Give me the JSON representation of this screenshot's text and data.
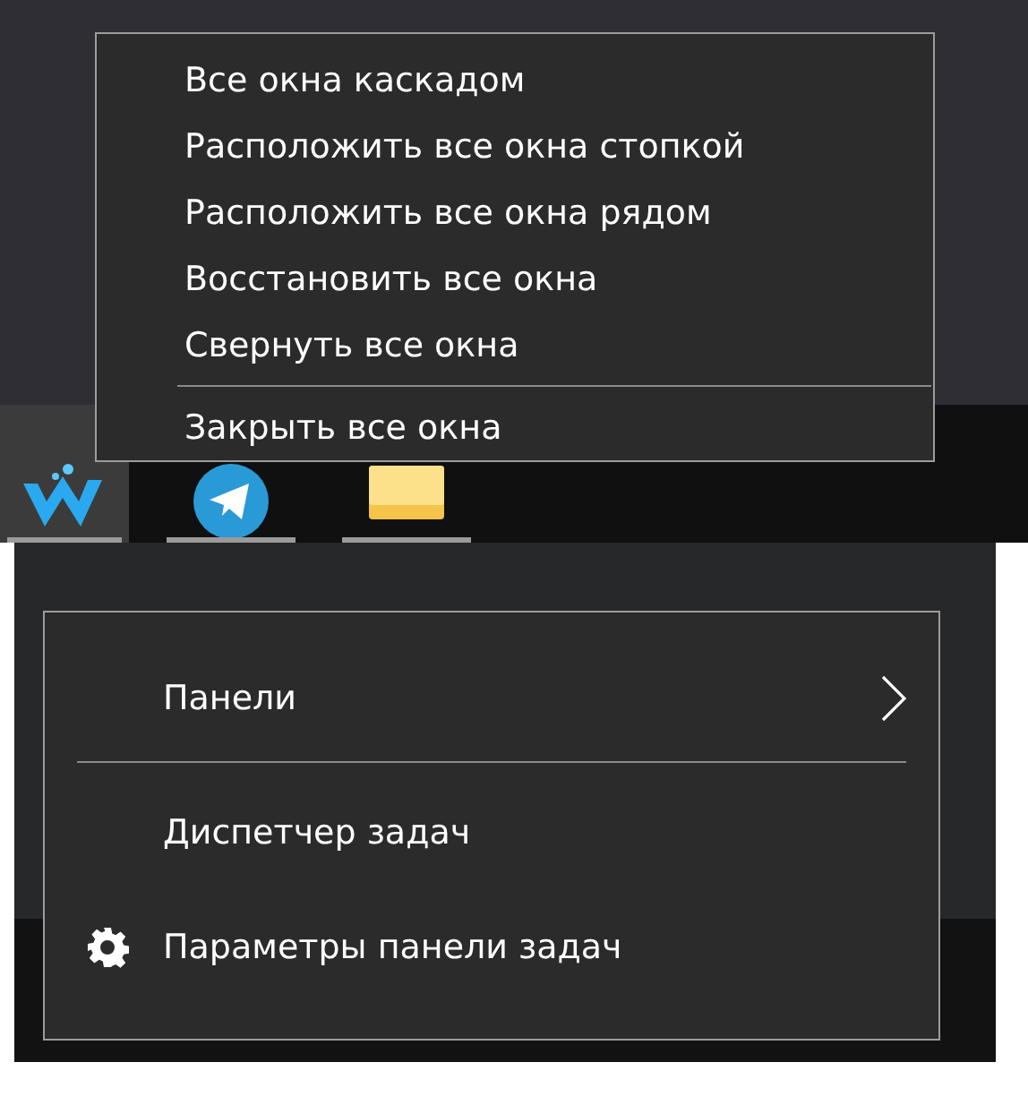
{
  "window_menu": {
    "items": [
      {
        "kind": "item",
        "label": "Все окна каскадом"
      },
      {
        "kind": "item",
        "label": "Расположить все окна стопкой"
      },
      {
        "kind": "item",
        "label": "Расположить все окна рядом"
      },
      {
        "kind": "item",
        "label": "Восстановить все окна"
      },
      {
        "kind": "item",
        "label": "Свернуть все окна"
      },
      {
        "kind": "separator"
      },
      {
        "kind": "item",
        "label": "Закрыть все окна"
      }
    ]
  },
  "taskbar": {
    "apps": [
      {
        "kind": "logo",
        "selected": true,
        "running": true
      },
      {
        "kind": "telegram",
        "selected": false,
        "running": true
      },
      {
        "kind": "folder",
        "selected": false,
        "running": true
      }
    ]
  },
  "taskbar_menu": {
    "items": [
      {
        "kind": "submenu",
        "label": "Панели"
      },
      {
        "kind": "separator"
      },
      {
        "kind": "item",
        "label": "Диспетчер задач"
      },
      {
        "kind": "settings",
        "label": "Параметры панели задач"
      }
    ]
  }
}
